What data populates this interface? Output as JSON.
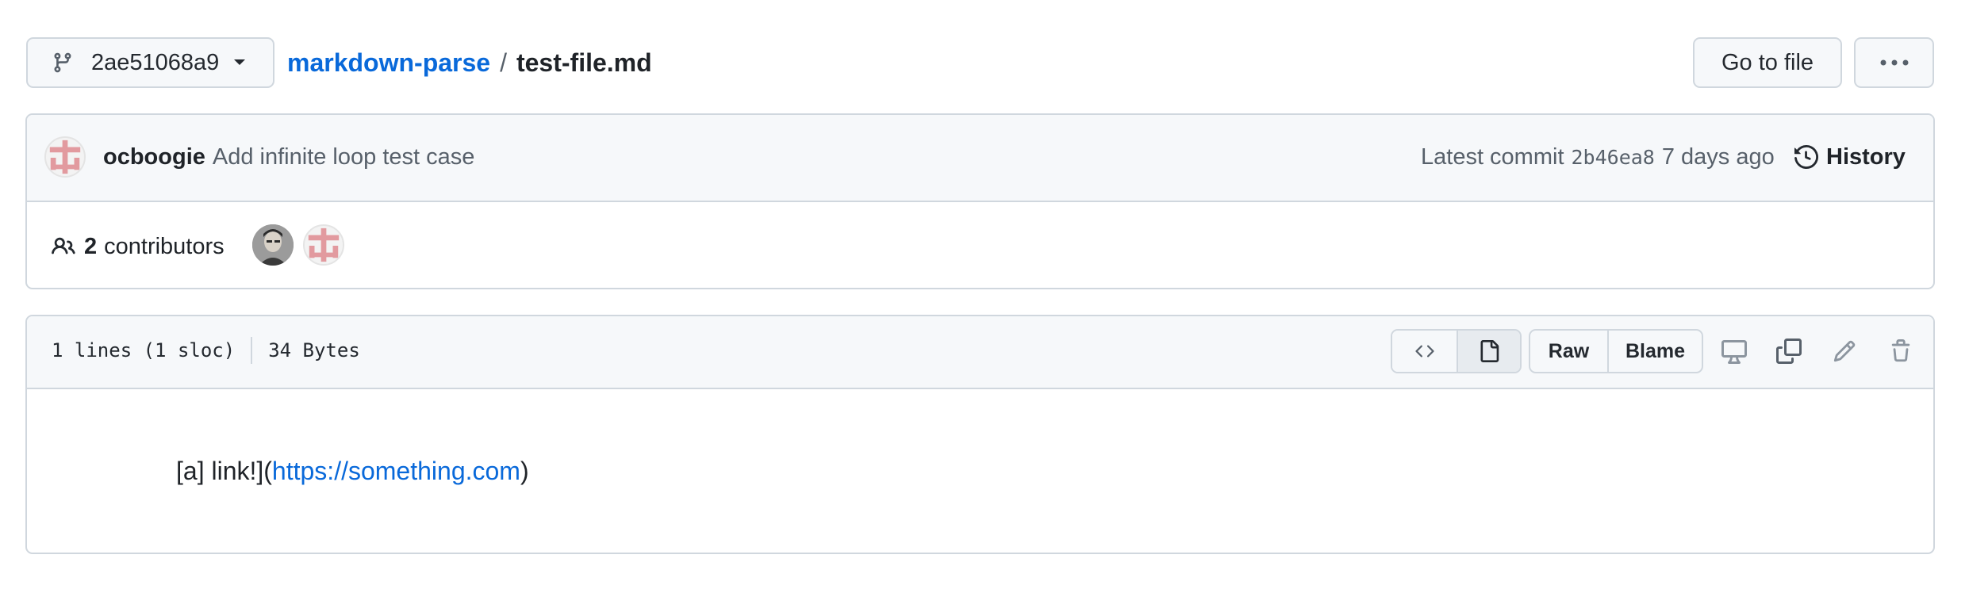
{
  "colors": {
    "link": "#0969da",
    "border": "#d0d7de",
    "header_bg": "#f6f8fa",
    "identicon": "#e29a9f"
  },
  "branch": {
    "name": "2ae51068a9",
    "icon": "git-branch-icon"
  },
  "breadcrumb": {
    "repo": "markdown-parse",
    "separator": "/",
    "file": "test-file.md"
  },
  "toolbar": {
    "go_to_file": "Go to file",
    "more": "more-horizontal-icon"
  },
  "commit": {
    "author": "ocboogie",
    "message": "Add infinite loop test case",
    "latest_label": "Latest commit",
    "sha": "2b46ea8",
    "age": "7 days ago",
    "history_label": "History"
  },
  "contributors": {
    "count": "2",
    "label": "contributors"
  },
  "file_info": {
    "lines": "1 lines (1 sloc)",
    "size": "34 Bytes"
  },
  "file_actions": {
    "raw": "Raw",
    "blame": "Blame"
  },
  "content": {
    "prefix": "[a] link!](",
    "url": "https://something.com",
    "suffix": ")"
  }
}
